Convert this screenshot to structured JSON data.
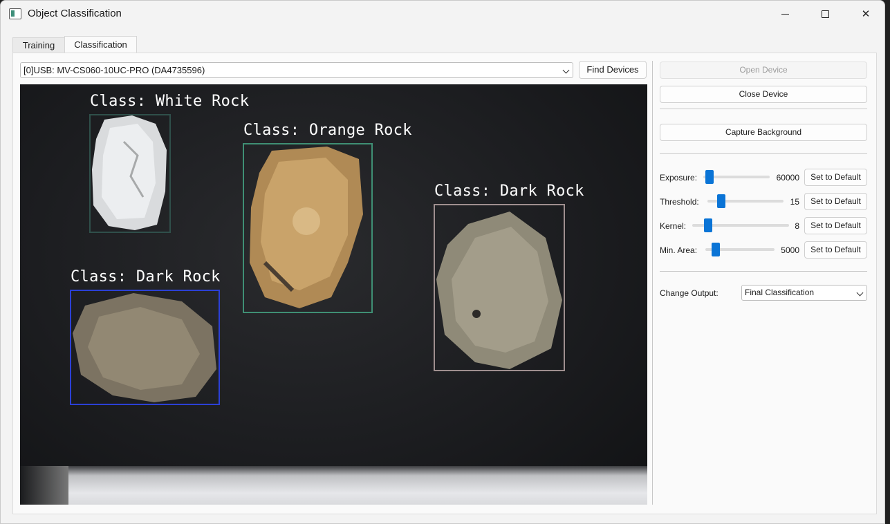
{
  "window": {
    "title": "Object Classification"
  },
  "tabs": [
    {
      "label": "Training",
      "active": false
    },
    {
      "label": "Classification",
      "active": true
    }
  ],
  "device": {
    "selected": "[0]USB:  MV-CS060-10UC-PRO (DA4735596)",
    "find_label": "Find Devices"
  },
  "detections": [
    {
      "label": "Class: White Rock",
      "color": "#2f4f4a"
    },
    {
      "label": "Class: Orange Rock",
      "color": "#3f8f74"
    },
    {
      "label": "Class: Dark Rock",
      "color": "#2b40d6"
    },
    {
      "label": "Class: Dark Rock",
      "color": "#9f8f8f"
    }
  ],
  "side": {
    "open_label": "Open Device",
    "close_label": "Close Device",
    "capture_label": "Capture Background",
    "controls": [
      {
        "label": "Exposure:",
        "value": "60000",
        "button": "Set to Default"
      },
      {
        "label": "Threshold:",
        "value": "15",
        "button": "Set to Default"
      },
      {
        "label": "Kernel:",
        "value": "8",
        "button": "Set to Default"
      },
      {
        "label": "Min. Area:",
        "value": "5000",
        "button": "Set to Default"
      }
    ],
    "output_label": "Change Output:",
    "output_value": "Final Classification"
  },
  "colors": {
    "accent": "#0a74d6"
  }
}
